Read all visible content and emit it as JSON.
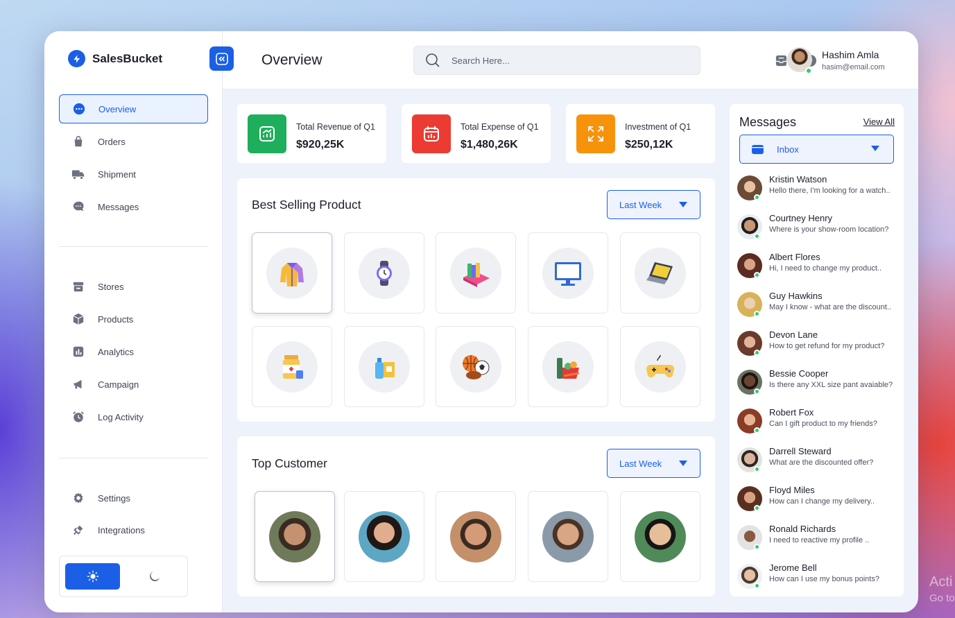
{
  "brand": {
    "name": "SalesBucket"
  },
  "sidebar": {
    "main_items": [
      {
        "label": "Overview",
        "icon": "dots-circle-icon",
        "active": true
      },
      {
        "label": "Orders",
        "icon": "bag-icon"
      },
      {
        "label": "Shipment",
        "icon": "truck-icon"
      },
      {
        "label": "Messages",
        "icon": "chat-bubble-icon"
      }
    ],
    "secondary_items": [
      {
        "label": "Stores",
        "icon": "store-icon"
      },
      {
        "label": "Products",
        "icon": "cube-icon"
      },
      {
        "label": "Analytics",
        "icon": "bar-chart-icon"
      },
      {
        "label": "Campaign",
        "icon": "megaphone-icon"
      },
      {
        "label": "Log Activity",
        "icon": "alarm-clock-icon"
      }
    ],
    "bottom_items": [
      {
        "label": "Settings",
        "icon": "gear-icon"
      },
      {
        "label": "Integrations",
        "icon": "plug-icon"
      }
    ]
  },
  "header": {
    "title": "Overview",
    "search_placeholder": "Search Here...",
    "user": {
      "name": "Hashim Amla",
      "email": "hasim@email.com"
    }
  },
  "stats": [
    {
      "label": "Total Revenue of Q1",
      "value": "$920,25K",
      "color": "#1fae5b",
      "icon": "chart-up-icon"
    },
    {
      "label": "Total Expense of Q1",
      "value": "$1,480,26K",
      "color": "#ec3b32",
      "icon": "calendar-chart-icon"
    },
    {
      "label": "Investment of Q1",
      "value": "$250,12K",
      "color": "#f7930a",
      "icon": "expand-icon"
    }
  ],
  "best_selling": {
    "title": "Best Selling Product",
    "filter": "Last Week",
    "products": [
      {
        "name": "jacket-icon"
      },
      {
        "name": "watch-icon"
      },
      {
        "name": "books-icon"
      },
      {
        "name": "monitor-icon"
      },
      {
        "name": "laptop-icon"
      },
      {
        "name": "medicine-icon"
      },
      {
        "name": "cleaning-products-icon"
      },
      {
        "name": "sports-balls-icon"
      },
      {
        "name": "groceries-icon"
      },
      {
        "name": "gamepad-icon"
      }
    ]
  },
  "top_customer": {
    "title": "Top Customer",
    "filter": "Last Week"
  },
  "messages": {
    "title": "Messages",
    "view_all": "View All",
    "folder": "Inbox",
    "items": [
      {
        "name": "Kristin Watson",
        "text": "Hello there, I'm looking for a watch.."
      },
      {
        "name": "Courtney Henry",
        "text": "Where is your show-room location?"
      },
      {
        "name": "Albert Flores",
        "text": "Hi, I need to change my product.."
      },
      {
        "name": "Guy Hawkins",
        "text": "May I know - what are the discount.."
      },
      {
        "name": "Devon Lane",
        "text": "How to get refund for my product?"
      },
      {
        "name": "Bessie Cooper",
        "text": "Is there any XXL size pant avaiable?"
      },
      {
        "name": "Robert Fox",
        "text": "Can I gift product to my friends?"
      },
      {
        "name": "Darrell Steward",
        "text": "What are the discounted offer?"
      },
      {
        "name": "Floyd Miles",
        "text": "How can I change my delivery.."
      },
      {
        "name": "Ronald Richards",
        "text": "I need to reactive my profile .."
      },
      {
        "name": "Jerome Bell",
        "text": "How can I use my bonus points?"
      }
    ]
  },
  "watermark": {
    "line1": "Acti",
    "line2": "Go to"
  }
}
